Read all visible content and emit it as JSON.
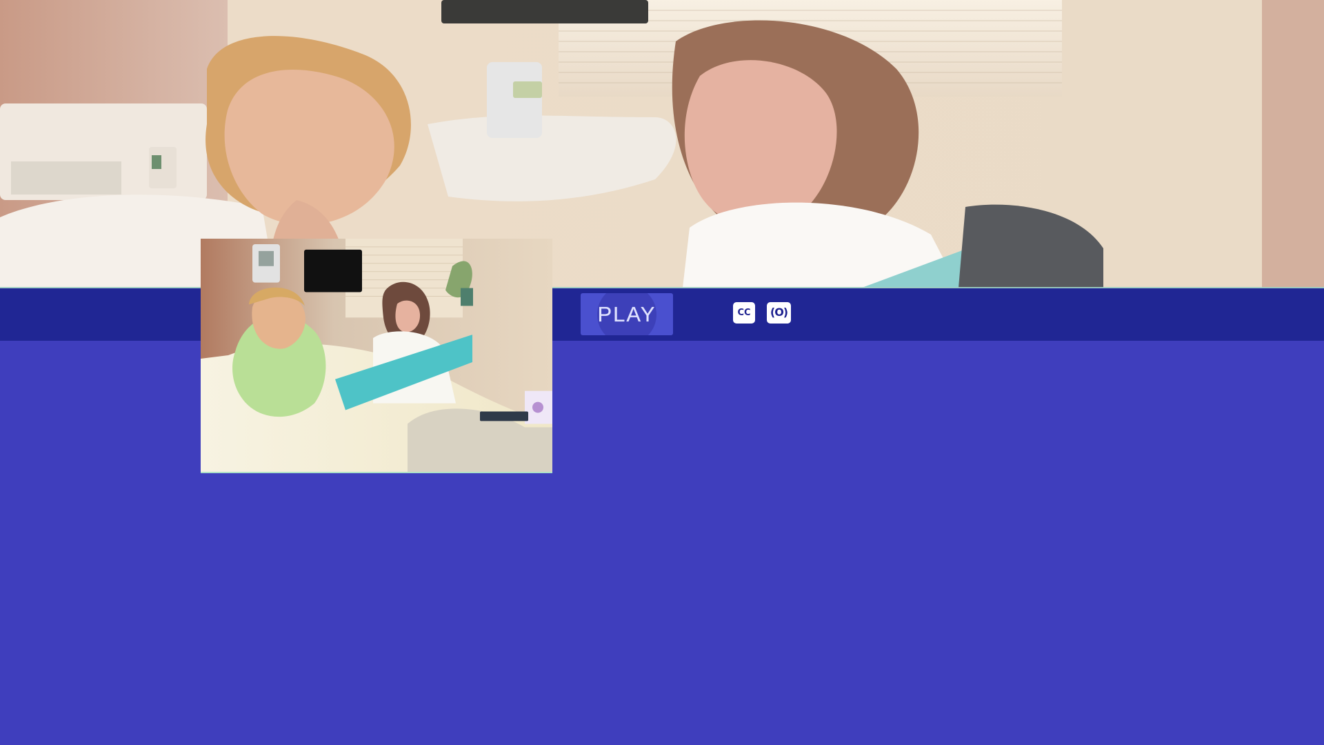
{
  "player": {
    "play_label": "PLAY",
    "cc_label": "CC",
    "audio_label": "(O)"
  },
  "colors": {
    "page_background": "#3f3ebd",
    "control_bar": "#202694",
    "play_button": "#4a50cf",
    "icon_fill": "#ffffff",
    "icon_text": "#1e2290"
  },
  "icons": {
    "closed_captions": "cc-icon",
    "audio_description": "audio-description-icon"
  }
}
